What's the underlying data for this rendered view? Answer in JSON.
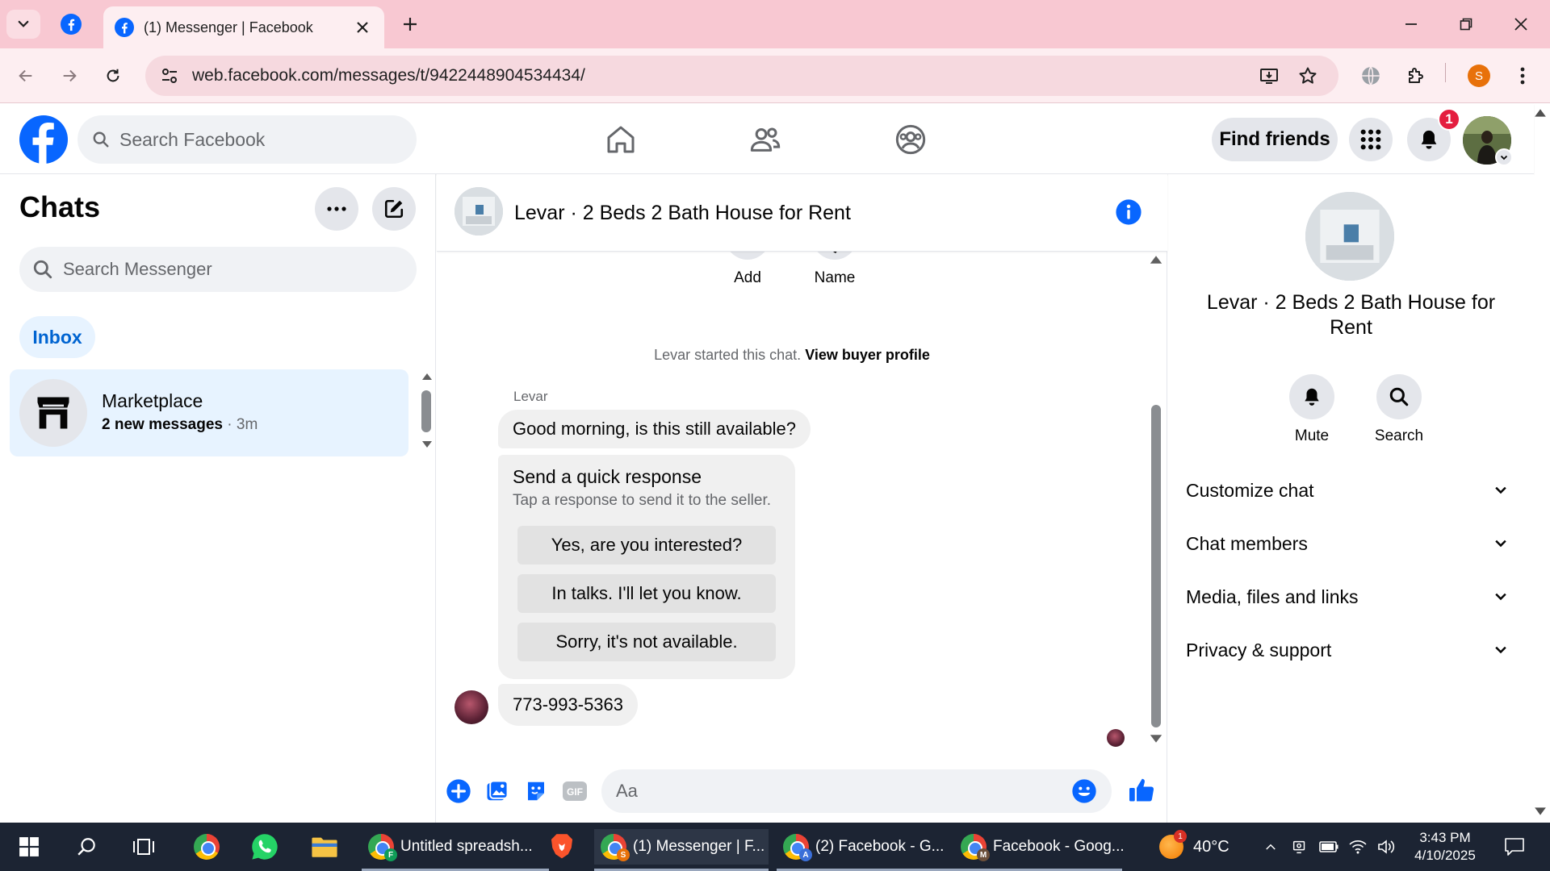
{
  "browser": {
    "tab_title": "(1) Messenger | Facebook",
    "url": "web.facebook.com/messages/t/9422448904534434/",
    "profile_initial": "S"
  },
  "header": {
    "search_placeholder": "Search Facebook",
    "find_friends_label": "Find friends",
    "notification_count": "1"
  },
  "chats": {
    "title": "Chats",
    "search_placeholder": "Search Messenger",
    "inbox_label": "Inbox",
    "items": [
      {
        "name": "Marketplace",
        "preview": "2 new messages",
        "time": "· 3m"
      }
    ]
  },
  "conversation": {
    "title": "Levar · 2 Beds 2 Bath House for Rent",
    "actions": [
      {
        "label": "Add"
      },
      {
        "label": "Name"
      }
    ],
    "started_text": "Levar started this chat.",
    "buyer_profile_link": "View buyer profile",
    "sender_name": "Levar",
    "messages": [
      {
        "text": "Good morning, is this still available?"
      },
      {
        "text": "773-993-5363"
      }
    ],
    "quick_response": {
      "title": "Send a quick response",
      "subtitle": "Tap a response to send it to the seller.",
      "options": [
        "Yes, are you interested?",
        "In talks. I'll let you know.",
        "Sorry, it's not available."
      ]
    },
    "composer_placeholder": "Aa"
  },
  "details": {
    "title": "Levar · 2 Beds 2 Bath House for Rent",
    "actions": [
      {
        "label": "Mute"
      },
      {
        "label": "Search"
      }
    ],
    "sections": [
      "Customize chat",
      "Chat members",
      "Media, files and links",
      "Privacy & support"
    ]
  },
  "taskbar": {
    "windows": [
      {
        "label": "Untitled spreadsh..."
      },
      {
        "label": "(1) Messenger | F..."
      },
      {
        "label": "(2) Facebook - G..."
      },
      {
        "label": "Facebook - Goog..."
      }
    ],
    "weather_temp": "40°C",
    "weather_badge": "1",
    "time": "3:43 PM",
    "date": "4/10/2025"
  },
  "colors": {
    "facebook_blue": "#0866ff",
    "tabstrip_pink": "#f8c8d2",
    "notification_red": "#e41e3f",
    "taskbar": "#1c2433"
  }
}
